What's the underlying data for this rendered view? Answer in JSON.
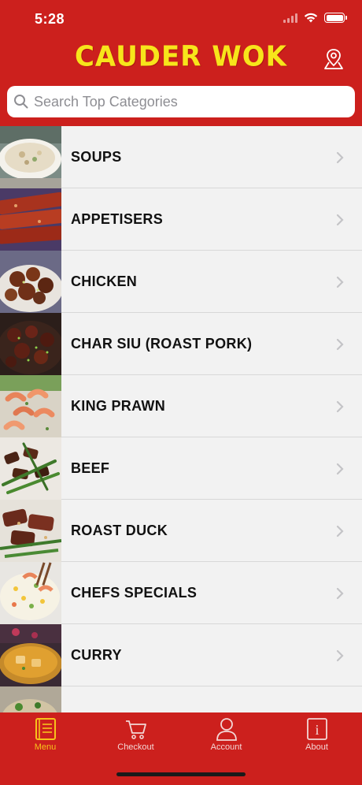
{
  "status": {
    "time": "5:28"
  },
  "header": {
    "title": "CAUDER WOK"
  },
  "search": {
    "placeholder": "Search Top Categories"
  },
  "categories": [
    {
      "label": "SOUPS",
      "thumb": "soup-thumbnail"
    },
    {
      "label": "APPETISERS",
      "thumb": "appetisers-thumbnail"
    },
    {
      "label": "CHICKEN",
      "thumb": "chicken-thumbnail"
    },
    {
      "label": "CHAR SIU (ROAST PORK)",
      "thumb": "char-siu-thumbnail"
    },
    {
      "label": "KING PRAWN",
      "thumb": "king-prawn-thumbnail"
    },
    {
      "label": "BEEF",
      "thumb": "beef-thumbnail"
    },
    {
      "label": "ROAST DUCK",
      "thumb": "roast-duck-thumbnail"
    },
    {
      "label": "CHEFS SPECIALS",
      "thumb": "chefs-specials-thumbnail"
    },
    {
      "label": "CURRY",
      "thumb": "curry-thumbnail"
    }
  ],
  "tabs": [
    {
      "label": "Menu",
      "icon": "menu-book-icon",
      "active": true
    },
    {
      "label": "Checkout",
      "icon": "cart-icon",
      "active": false
    },
    {
      "label": "Account",
      "icon": "person-icon",
      "active": false
    },
    {
      "label": "About",
      "icon": "info-icon",
      "active": false
    }
  ],
  "colors": {
    "brand_red": "#cc201d",
    "title_yellow": "#f7e51b",
    "active_tab": "#f7c21b",
    "list_background": "#f2f2f2"
  }
}
